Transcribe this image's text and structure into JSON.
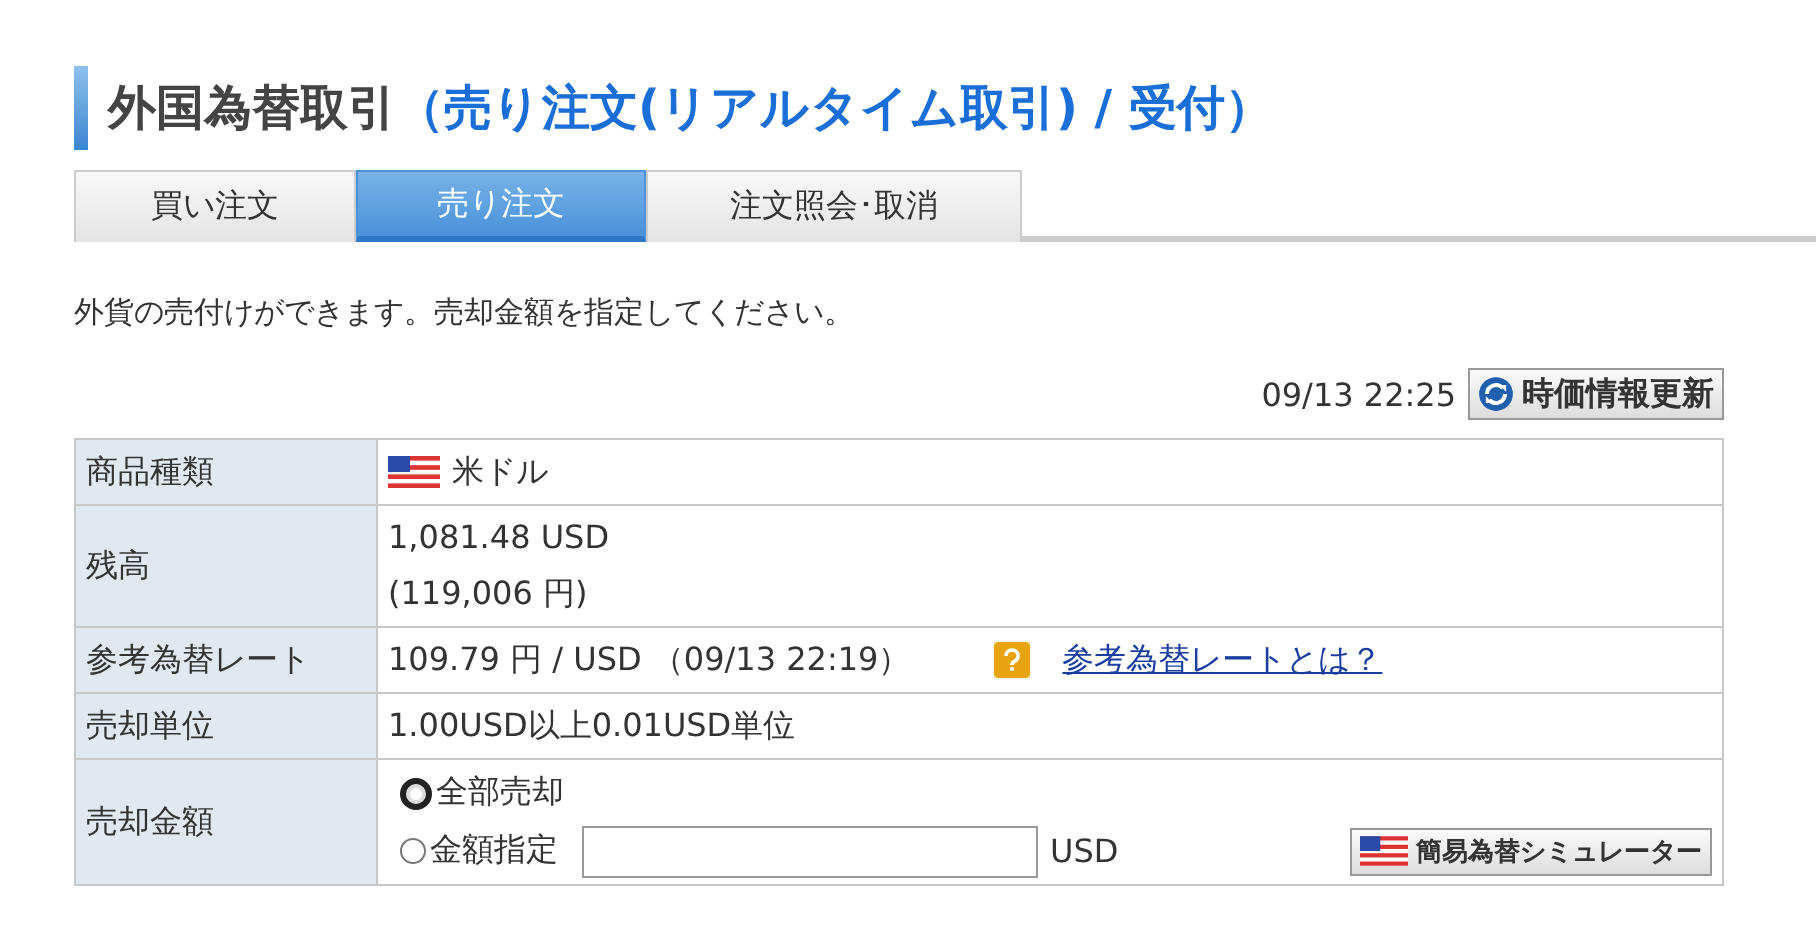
{
  "title": {
    "main": "外国為替取引",
    "sub": "（売り注文(リアルタイム取引) / 受付）"
  },
  "tabs": [
    {
      "label": "買い注文",
      "selected": false
    },
    {
      "label": "売り注文",
      "selected": true
    },
    {
      "label": "注文照会･取消",
      "selected": false
    }
  ],
  "description": "外貨の売付けができます。売却金額を指定してください。",
  "update": {
    "time": "09/13 22:25",
    "button": "時価情報更新"
  },
  "table": {
    "rows": [
      {
        "kind": "currency",
        "label": "商品種類",
        "value": "米ドル"
      },
      {
        "kind": "balance",
        "label": "残高",
        "lines": [
          "1,081.48 USD",
          "(119,006 円)"
        ]
      },
      {
        "kind": "rate",
        "label": "参考為替レート",
        "value": "109.79 円 / USD （09/13 22:19）",
        "link": "参考為替レートとは？"
      },
      {
        "kind": "text",
        "label": "売却単位",
        "value": "1.00USD以上0.01USD単位"
      },
      {
        "kind": "amount",
        "label": "売却金額",
        "options": [
          {
            "label": "全部売却",
            "selected": true
          },
          {
            "label": "金額指定",
            "selected": false
          }
        ],
        "unit": "USD",
        "button": "簡易為替シミュレーター"
      }
    ]
  }
}
